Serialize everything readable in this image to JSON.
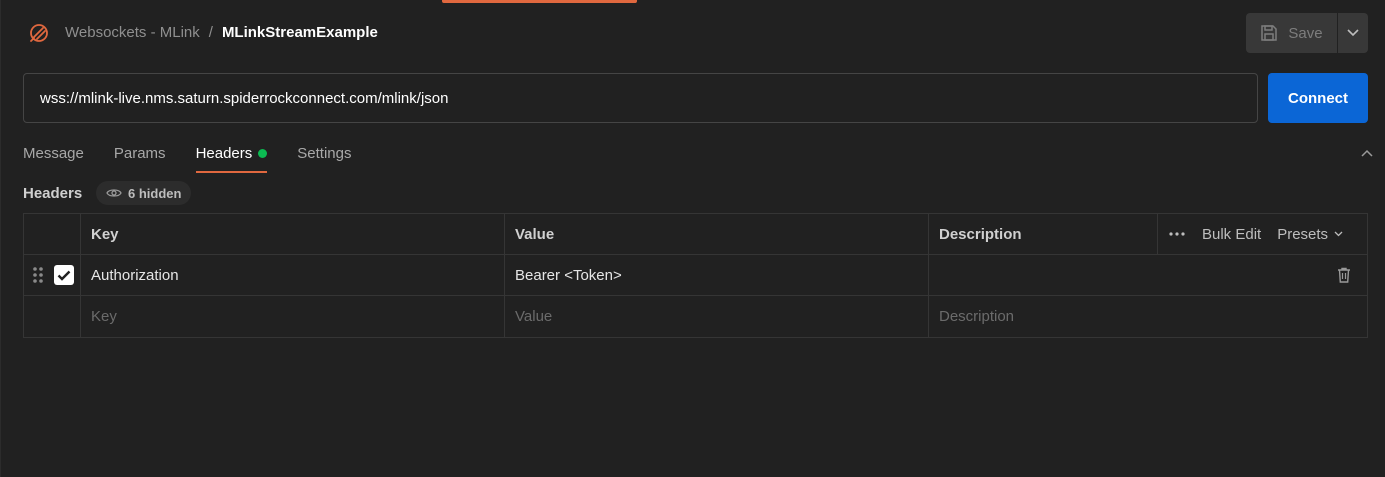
{
  "breadcrumb": {
    "collection": "Websockets - MLink",
    "separator": "/",
    "request": "MLinkStreamExample"
  },
  "toolbar": {
    "save_label": "Save",
    "save_icon": "floppy-disk-icon",
    "dropdown_icon": "chevron-down-icon"
  },
  "url": {
    "value": "wss://mlink-live.nms.saturn.spiderrockconnect.com/mlink/json"
  },
  "connect_label": "Connect",
  "tabs": [
    {
      "label": "Message"
    },
    {
      "label": "Params"
    },
    {
      "label": "Headers",
      "active": true,
      "indicator": "green-dot"
    },
    {
      "label": "Settings"
    }
  ],
  "headers_section": {
    "title": "Headers",
    "hidden_label": "6 hidden"
  },
  "table": {
    "columns": {
      "key": "Key",
      "value": "Value",
      "description": "Description"
    },
    "actions": {
      "bulk_edit": "Bulk Edit",
      "presets": "Presets"
    },
    "rows": [
      {
        "checked": true,
        "key": "Authorization",
        "value": "Bearer <Token>",
        "description": ""
      }
    ],
    "new_row": {
      "key_placeholder": "Key",
      "value_placeholder": "Value",
      "description_placeholder": "Description"
    }
  },
  "colors": {
    "accent": "#e0683f",
    "connect": "#0b66d6",
    "status_dot": "#0cbb52",
    "background": "#212121"
  }
}
